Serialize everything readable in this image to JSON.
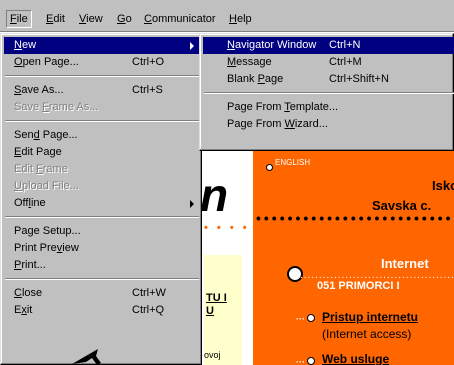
{
  "menubar": {
    "items": [
      {
        "label": "File",
        "ul": "F",
        "rest": "ile"
      },
      {
        "label": "Edit",
        "ul": "E",
        "rest": "dit"
      },
      {
        "label": "View",
        "ul": "V",
        "rest": "iew"
      },
      {
        "label": "Go",
        "ul": "G",
        "rest": "o"
      },
      {
        "label": "Communicator",
        "ul": "C",
        "rest": "ommunicator"
      },
      {
        "label": "Help",
        "ul": "H",
        "rest": "elp"
      }
    ]
  },
  "file_menu": {
    "items": [
      {
        "pre": "",
        "ul": "N",
        "post": "ew",
        "shortcut": ""
      },
      {
        "pre": "",
        "ul": "O",
        "post": "pen Page...",
        "shortcut": "Ctrl+O"
      },
      {
        "pre": "",
        "ul": "S",
        "post": "ave As...",
        "shortcut": "Ctrl+S"
      },
      {
        "pre": "Save ",
        "ul": "F",
        "post": "rame As...",
        "shortcut": ""
      },
      {
        "pre": "Sen",
        "ul": "d",
        "post": " Page...",
        "shortcut": ""
      },
      {
        "pre": "",
        "ul": "E",
        "post": "dit Page",
        "shortcut": ""
      },
      {
        "pre": "Edit ",
        "ul": "F",
        "post": "rame",
        "shortcut": ""
      },
      {
        "pre": "",
        "ul": "U",
        "post": "pload File...",
        "shortcut": ""
      },
      {
        "pre": "Off",
        "ul": "l",
        "post": "ine",
        "shortcut": ""
      },
      {
        "pre": "Page Setup",
        "ul": "",
        "post": "...",
        "shortcut": ""
      },
      {
        "pre": "Print Pre",
        "ul": "v",
        "post": "iew",
        "shortcut": ""
      },
      {
        "pre": "",
        "ul": "P",
        "post": "rint...",
        "shortcut": ""
      },
      {
        "pre": "",
        "ul": "C",
        "post": "lose",
        "shortcut": "Ctrl+W"
      },
      {
        "pre": "E",
        "ul": "x",
        "post": "it",
        "shortcut": "Ctrl+Q"
      }
    ]
  },
  "new_submenu": {
    "items": [
      {
        "pre": "",
        "ul": "N",
        "post": "avigator Window",
        "shortcut": "Ctrl+N"
      },
      {
        "pre": "",
        "ul": "M",
        "post": "essage",
        "shortcut": "Ctrl+M"
      },
      {
        "pre": "Blank ",
        "ul": "P",
        "post": "age",
        "shortcut": "Ctrl+Shift+N"
      },
      {
        "pre": "Page From ",
        "ul": "T",
        "post": "emplate...",
        "shortcut": ""
      },
      {
        "pre": "Page From ",
        "ul": "W",
        "post": "izard...",
        "shortcut": ""
      }
    ]
  },
  "page": {
    "english": "ENGLISH",
    "isko": "Isko",
    "savska": "Savska c.",
    "internet": "Internet",
    "phone": "051  PRIMORCI I",
    "link1": "Pristup internetu",
    "link1_sub": "(Internet access)",
    "link2": "Web usluge",
    "left1": "TU I",
    "left2": "U",
    "left3": "ovoj"
  },
  "colors": {
    "menu": "#c0c0c0",
    "highlight": "#000080",
    "page_accent": "#ff6600"
  }
}
